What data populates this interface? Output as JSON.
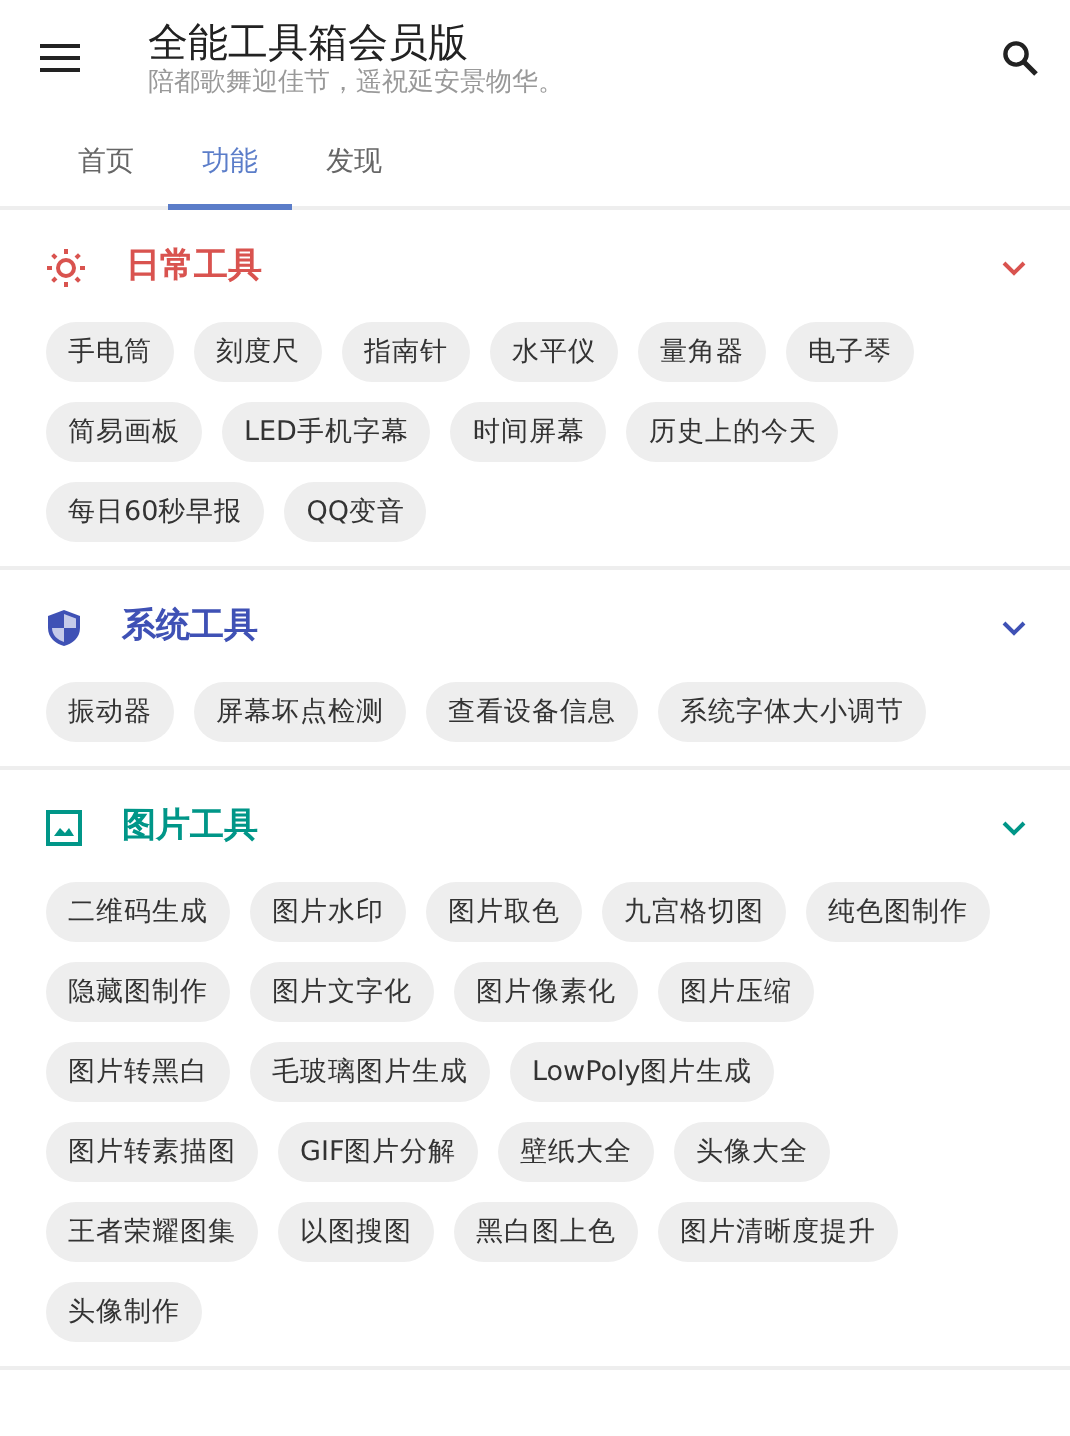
{
  "app_bar": {
    "title": "全能工具箱会员版",
    "subtitle": "陪都歌舞迎佳节，遥祝延安景物华。"
  },
  "tabs": [
    {
      "label": "首页",
      "selected": false
    },
    {
      "label": "功能",
      "selected": true
    },
    {
      "label": "发现",
      "selected": false
    }
  ],
  "sections": [
    {
      "title": "日常工具",
      "kind": "sun",
      "color": "#d9534f",
      "expanded": true,
      "tools": [
        "手电筒",
        "刻度尺",
        "指南针",
        "水平仪",
        "量角器",
        "电子琴",
        "简易画板",
        "LED手机字幕",
        "时间屏幕",
        "历史上的今天",
        "每日60秒早报",
        "QQ变音"
      ]
    },
    {
      "title": "系统工具",
      "kind": "shield",
      "color": "#3f51b5",
      "expanded": true,
      "tools": [
        "振动器",
        "屏幕坏点检测",
        "查看设备信息",
        "系统字体大小调节"
      ]
    },
    {
      "title": "图片工具",
      "kind": "image",
      "color": "#009688",
      "expanded": true,
      "tools": [
        "二维码生成",
        "图片水印",
        "图片取色",
        "九宫格切图",
        "纯色图制作",
        "隐藏图制作",
        "图片文字化",
        "图片像素化",
        "图片压缩",
        "图片转黑白",
        "毛玻璃图片生成",
        "LowPoly图片生成",
        "图片转素描图",
        "GIF图片分解",
        "壁纸大全",
        "头像大全",
        "王者荣耀图集",
        "以图搜图",
        "黑白图上色",
        "图片清晰度提升",
        "头像制作"
      ]
    }
  ]
}
